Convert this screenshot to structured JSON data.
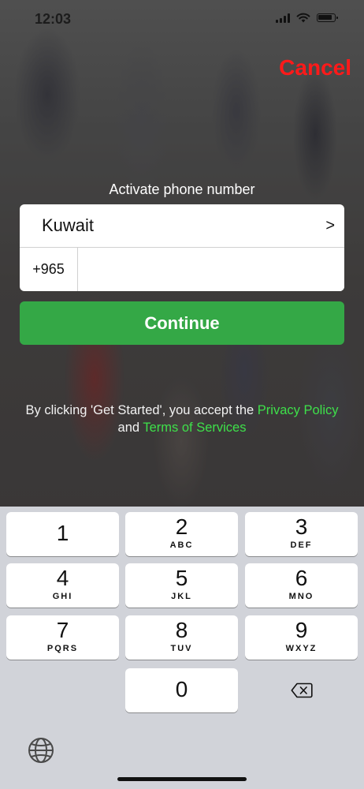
{
  "status_bar": {
    "time": "12:03"
  },
  "header": {
    "cancel_label": "Cancel"
  },
  "form": {
    "title": "Activate phone number",
    "country": "Kuwait",
    "country_chevron": ">",
    "dial_code": "+965",
    "phone_value": "",
    "continue_label": "Continue"
  },
  "terms": {
    "prefix": "By clicking 'Get Started', you accept the",
    "privacy_link": "Privacy Policy",
    "and": "and",
    "terms_link": "Terms of Services"
  },
  "keypad": {
    "keys": [
      {
        "digit": "1",
        "letters": ""
      },
      {
        "digit": "2",
        "letters": "ABC"
      },
      {
        "digit": "3",
        "letters": "DEF"
      },
      {
        "digit": "4",
        "letters": "GHI"
      },
      {
        "digit": "5",
        "letters": "JKL"
      },
      {
        "digit": "6",
        "letters": "MNO"
      },
      {
        "digit": "7",
        "letters": "PQRS"
      },
      {
        "digit": "8",
        "letters": "TUV"
      },
      {
        "digit": "9",
        "letters": "WXYZ"
      },
      {
        "digit": "0",
        "letters": ""
      }
    ]
  },
  "colors": {
    "cancel": "#ff1a1a",
    "continue_button": "#34a846",
    "link": "#3ee04a",
    "keyboard_bg": "#d1d3d9"
  },
  "icons": [
    "signal-icon",
    "wifi-icon",
    "battery-icon",
    "backspace-icon",
    "globe-icon"
  ]
}
